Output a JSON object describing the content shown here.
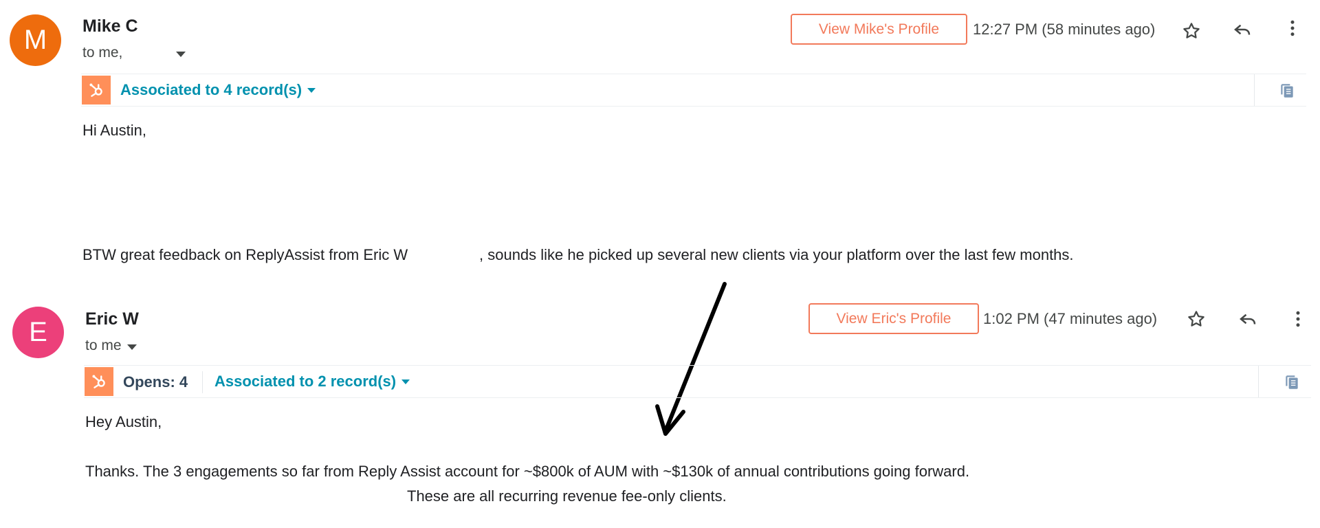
{
  "messages": [
    {
      "avatar_letter": "M",
      "avatar_color": "#ee6c0d",
      "sender": "Mike C",
      "to_line": "to me,",
      "profile_button": "View Mike's Profile",
      "time": "12:27 PM (58 minutes ago)",
      "associated": "Associated to 4 record(s)",
      "body": {
        "greeting": "Hi Austin,",
        "line1": "BTW great feedback on ReplyAssist from Eric W",
        "line1_cont": ", sounds like he picked up several new clients via your platform over the last few months."
      }
    },
    {
      "avatar_letter": "E",
      "avatar_color": "#ec407a",
      "sender": "Eric W",
      "to_line": "to me",
      "profile_button": "View Eric's Profile",
      "time": "1:02 PM (47 minutes ago)",
      "opens": "Opens: 4",
      "associated": "Associated to 2 record(s)",
      "body": {
        "greeting": "Hey Austin,",
        "line1": "Thanks.  The 3 engagements so far from Reply Assist account for ~$800k of AUM with ~$130k of annual contributions going forward.",
        "line2": "These are all recurring revenue fee-only clients."
      }
    }
  ],
  "icons": {
    "star": "star-icon",
    "reply": "reply-icon",
    "more": "more-vert-icon",
    "copy": "copy-icon",
    "hubspot": "hubspot-icon"
  },
  "colors": {
    "hubspot_orange": "#ff8f59",
    "link_teal": "#0091ae",
    "profile_border": "#f2795a"
  }
}
